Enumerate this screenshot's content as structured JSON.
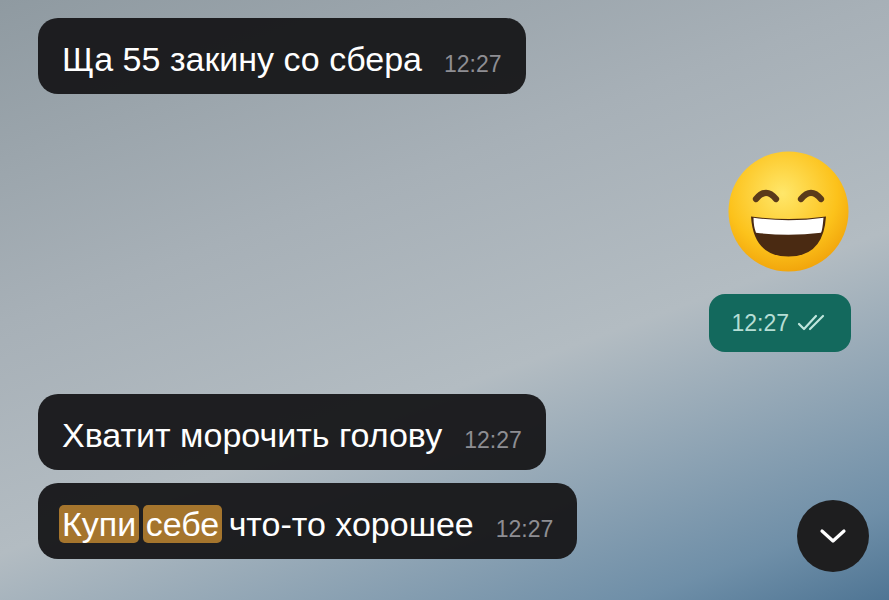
{
  "messages": [
    {
      "kind": "text",
      "direction": "incoming",
      "segments": [
        {
          "text": "Ща 55 закину со сбера",
          "highlighted": false
        }
      ],
      "time": "12:27",
      "read": false
    },
    {
      "kind": "emoji",
      "direction": "outgoing",
      "segments": [],
      "time": "12:27",
      "read": true
    },
    {
      "kind": "text",
      "direction": "incoming",
      "segments": [
        {
          "text": "Хватит морочить голову",
          "highlighted": false
        }
      ],
      "time": "12:27",
      "read": false
    },
    {
      "kind": "text",
      "direction": "incoming",
      "segments": [
        {
          "text": "Купи",
          "highlighted": true
        },
        {
          "text": " ",
          "highlighted": false
        },
        {
          "text": "себе",
          "highlighted": true
        },
        {
          "text": " что-то хорошее",
          "highlighted": false
        }
      ],
      "time": "12:27",
      "read": false
    }
  ]
}
